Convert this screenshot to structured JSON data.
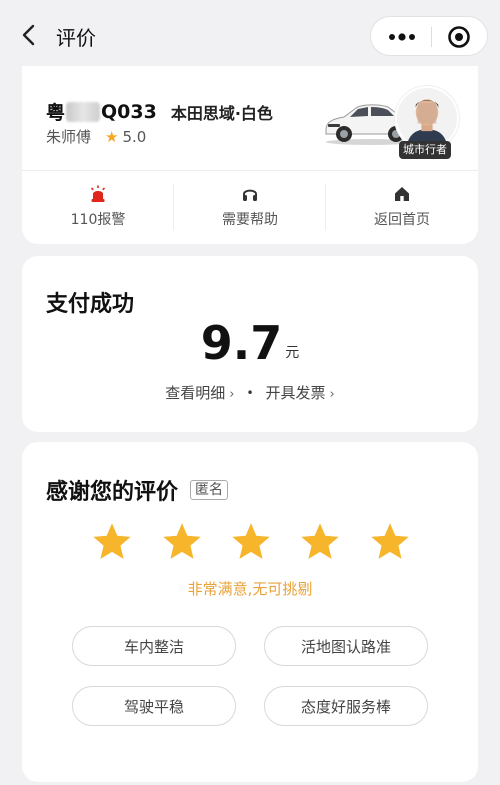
{
  "navbar": {
    "title": "评价"
  },
  "driver": {
    "plate_prefix": "粤",
    "plate_suffix": "Q033",
    "car_model": "本田思域·白色",
    "name": "朱师傅",
    "rating": "5.0",
    "badge": "城市行者"
  },
  "actions": [
    {
      "label": "110报警",
      "icon": "alarm-light-icon",
      "color": "#e0251b"
    },
    {
      "label": "需要帮助",
      "icon": "headset-icon",
      "color": "#333333"
    },
    {
      "label": "返回首页",
      "icon": "home-icon",
      "color": "#333333"
    }
  ],
  "payment": {
    "title": "支付成功",
    "amount": "9.7",
    "unit": "元",
    "detail_link": "查看明细",
    "invoice_link": "开具发票"
  },
  "evaluation": {
    "title": "感谢您的评价",
    "anonymous": "匿名",
    "stars": 5,
    "star_color": "#f7b52c",
    "rating_text": "非常满意,无可挑剔",
    "tags": [
      "车内整洁",
      "活地图认路准",
      "驾驶平稳",
      "态度好服务棒"
    ]
  }
}
